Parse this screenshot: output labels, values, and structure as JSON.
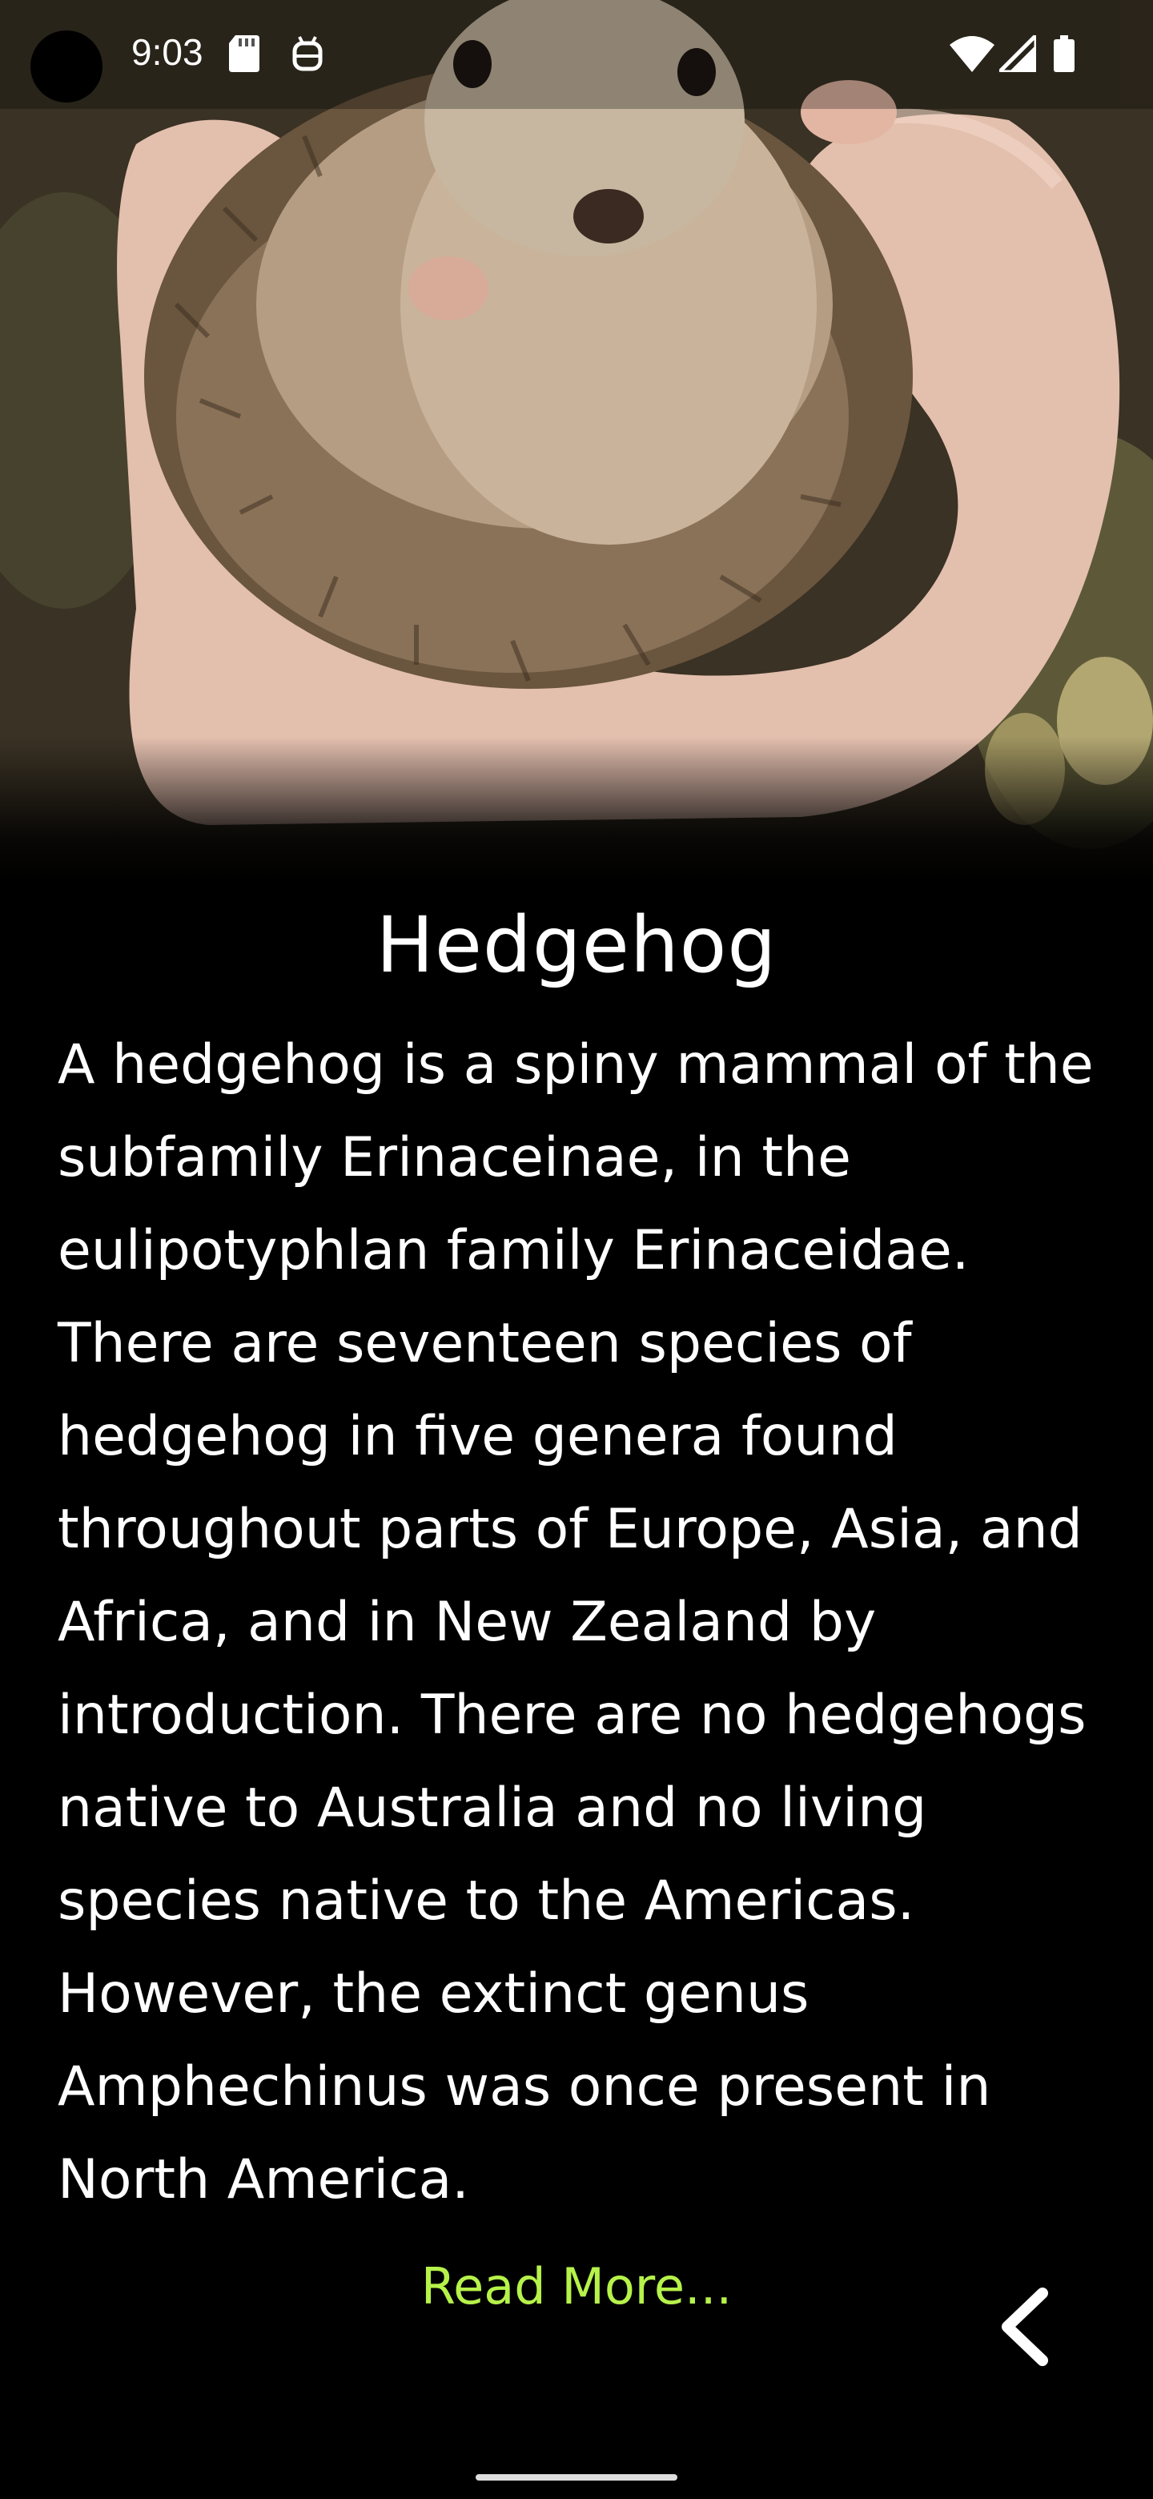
{
  "status_bar": {
    "time": "9:03",
    "icons": [
      "sd-card-icon",
      "android-debug-icon",
      "wifi-icon",
      "signal-icon",
      "battery-icon"
    ]
  },
  "hero": {
    "image_subject": "hedgehog-in-hand-photo"
  },
  "article": {
    "title": "Hedgehog",
    "description": "A hedgehog is a spiny mammal of the subfamily Erinaceinae, in the eulipotyphlan family Erinaceidae. There are seventeen species of hedgehog in five genera found throughout parts of Europe, Asia, and Africa, and in New Zealand by introduction. There are no hedgehogs native to Australia and no living species native to the Americas. However, the extinct genus Amphechinus was once present in North America.",
    "read_more_label": "Read More..."
  },
  "navigation": {
    "back_icon": "chevron-left-icon"
  },
  "colors": {
    "background": "#000000",
    "text": "#ffffff",
    "link": "#b6f24a"
  }
}
